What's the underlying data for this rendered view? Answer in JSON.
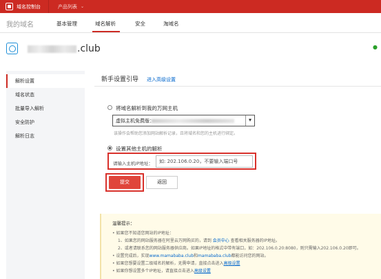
{
  "topbar": {
    "title": "域名控制台",
    "product_menu": "产品列表",
    "caret": "⌄"
  },
  "nav": {
    "page_title": "我的域名",
    "tabs": [
      {
        "label": "基本管理"
      },
      {
        "label": "域名解析"
      },
      {
        "label": "安全"
      },
      {
        "label": "淘域名"
      }
    ]
  },
  "domain": {
    "suffix": ".club"
  },
  "sidebar": {
    "items": [
      {
        "label": "解析设置"
      },
      {
        "label": "域名状态"
      },
      {
        "label": "批量导入解析"
      },
      {
        "label": "安全防护"
      },
      {
        "label": "解析日志"
      }
    ]
  },
  "main": {
    "title": "新手设置引导",
    "advanced_link": "进入高级设置",
    "option1_label": "将域名解析到我的万网主机",
    "select_value": "虚拟主机免费版：",
    "select_arrow": "▾",
    "hint": "该操作会帮助您添加网站解析记录，且将域名和您的主机进行绑定。",
    "option2_label": "设置其他主机的解析",
    "ip_label": "请输入主机IP地址：",
    "ip_placeholder": "如: 202.106.0.20，不要输入端口号",
    "submit_label": "提交",
    "back_label": "返回"
  },
  "notice": {
    "title": "温馨提示：",
    "lines": [
      {
        "a": "• 如果您不知道您网站的IP地址："
      },
      {
        "a": "1、如果您的网站服务器在阿里云万网购买的，请到 ",
        "b": "会员中心",
        "c": " 查看相关服务器的IP地址。"
      },
      {
        "a": "2、或者请联系您的网站服务器供应商。如果IP地址的格式中带有端口，如：202.106.0.20:8080，则只需输入202.106.0.20即可。"
      },
      {
        "a": "• 设置完成后，实现",
        "b": "www.mamababa.club",
        "c": "和",
        "d": "mamababa.club",
        "e": "都能访问您的网站。"
      },
      {
        "a": "• 如果您想要设置二级域名的解析，无需申请，直接点击进入",
        "b": "高级设置"
      },
      {
        "a": "• 如果你想设置多个IP地址，请直接点击进入",
        "b": "高级设置"
      }
    ]
  },
  "colors": {
    "brand_red": "#cc2a22",
    "link_blue": "#0066cc",
    "notice_bg": "#fffbe8"
  },
  "icons": [
    "domain-icon",
    "chevron-down-icon",
    "radio-icon"
  ]
}
